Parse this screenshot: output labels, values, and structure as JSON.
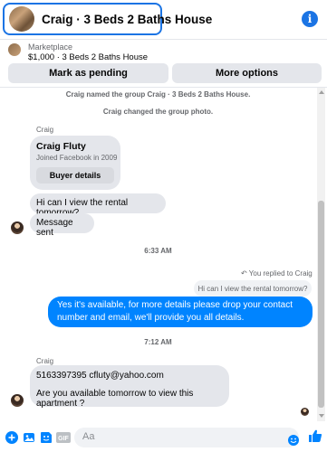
{
  "header": {
    "title": "Craig · 3 Beds 2 Baths House",
    "info_icon": "info-icon"
  },
  "marketplace": {
    "label": "Marketplace",
    "listing": "$1,000 · 3 Beds 2 Baths House",
    "buttons": {
      "mark_pending": "Mark as pending",
      "more_options": "More options"
    }
  },
  "chat": {
    "system_messages": [
      "Craig named the group Craig · 3 Beds 2 Baths House.",
      "Craig changed the group photo."
    ],
    "sender_name": "Craig",
    "profile_card": {
      "name": "Craig Fluty",
      "joined": "Joined Facebook in 2009",
      "button": "Buyer details"
    },
    "incoming_1": "Hi can I view the rental tomorrow?",
    "incoming_2": "Message sent",
    "timestamp_1": "6:33 AM",
    "reply_note": "You replied to Craig",
    "reply_quote": "Hi can I view the rental tomorrow?",
    "outgoing_1": "Yes it's available, for more details please drop your contact number and email, we'll provide you all details.",
    "timestamp_2": "7:12 AM",
    "sender_name_2": "Craig",
    "incoming_3_line1": "5163397395 cfluty@yahoo.com",
    "incoming_3_line2": "Are you available tomorrow to view this apartment ?"
  },
  "composer": {
    "placeholder": "Aa",
    "icons": [
      "plus-icon",
      "photo-icon",
      "sticker-icon",
      "gif-icon",
      "emoji-icon",
      "like-icon"
    ]
  },
  "colors": {
    "accent": "#1b74e4",
    "outgoing_bubble": "#0084ff",
    "incoming_bubble": "#e4e6eb"
  }
}
